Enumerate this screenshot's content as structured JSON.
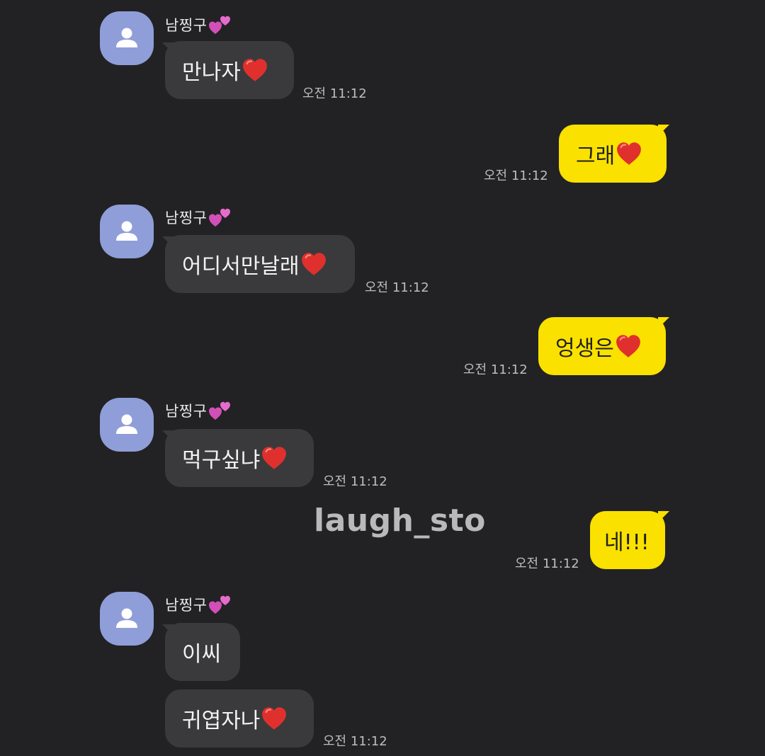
{
  "chat": {
    "contact_name": "남찡구",
    "contact_emoji": "two-hearts",
    "messages": [
      {
        "side": "in",
        "text": "만나자",
        "time": "오전 11:12"
      },
      {
        "side": "out",
        "text": "그래",
        "time": "오전 11:12"
      },
      {
        "side": "in",
        "text": "어디서만날래",
        "time": "오전 11:12"
      },
      {
        "side": "out",
        "text": "엉생은",
        "time": "오전 11:12"
      },
      {
        "side": "in",
        "text": "먹구싶냐",
        "time": "오전 11:12"
      },
      {
        "side": "out",
        "text": "네!!!",
        "time": "오전 11:12"
      },
      {
        "side": "in",
        "text": "이씨",
        "time": ""
      },
      {
        "side": "in",
        "text": "귀엽자나",
        "time": "오전 11:12"
      }
    ]
  },
  "watermark": "laugh_sto",
  "colors": {
    "background": "#222224",
    "incoming_bubble": "#3a3a3c",
    "outgoing_bubble": "#fae100",
    "avatar": "#8f9ed8",
    "heart": "#e0302e"
  }
}
